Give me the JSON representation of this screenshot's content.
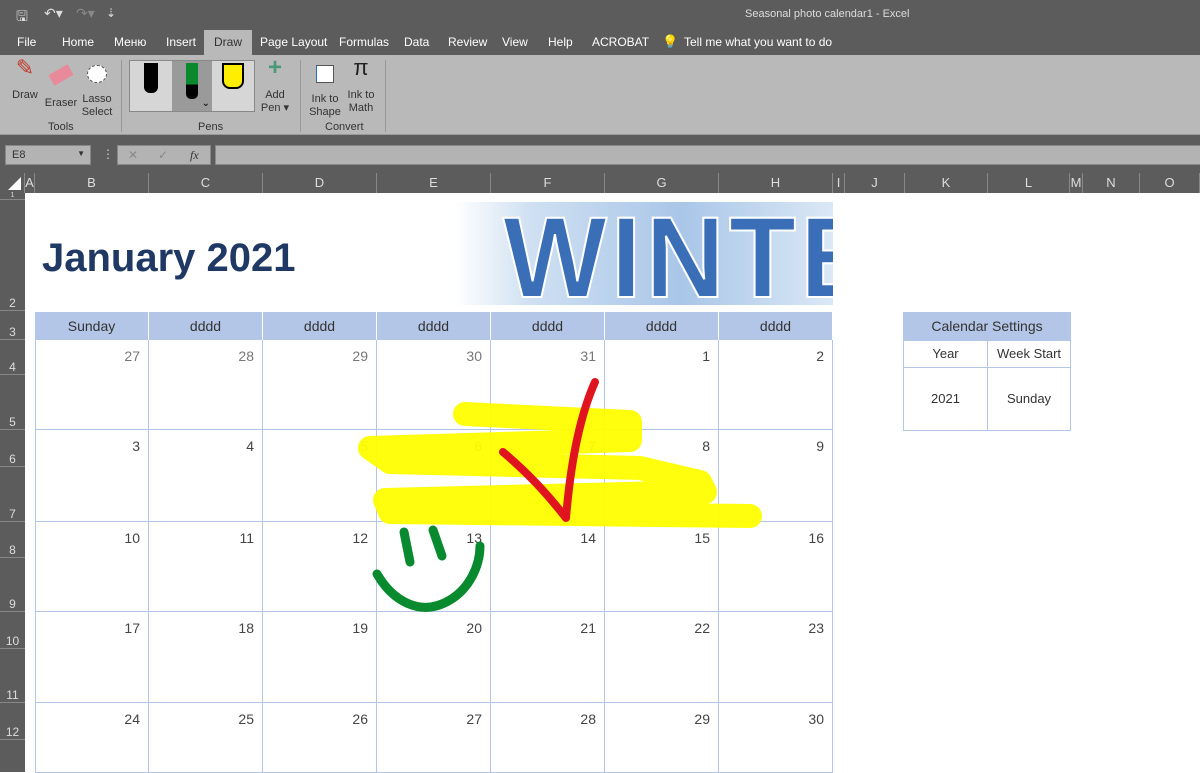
{
  "window": {
    "title": "Seasonal photo calendar1  -  Excel"
  },
  "tabs": [
    "File",
    "Home",
    "Меню",
    "Insert",
    "Draw",
    "Page Layout",
    "Formulas",
    "Data",
    "Review",
    "View",
    "Help",
    "ACROBAT"
  ],
  "tell_me": "Tell me what you want to do",
  "ribbon": {
    "draw": "Draw",
    "eraser": "Eraser",
    "lasso1": "Lasso",
    "lasso2": "Select",
    "tools": "Tools",
    "pens": "Pens",
    "addpen1": "Add",
    "addpen2": "Pen ▾",
    "shape1": "Ink to",
    "shape2": "Shape",
    "math1": "Ink to",
    "math2": "Math",
    "convert": "Convert"
  },
  "formula": {
    "namebox": "E8",
    "value": ""
  },
  "columns": [
    "A",
    "B",
    "C",
    "D",
    "E",
    "F",
    "G",
    "H",
    "I",
    "J",
    "K",
    "L",
    "M",
    "N",
    "O"
  ],
  "rows": [
    "1",
    "2",
    "3",
    "4",
    "5",
    "6",
    "7",
    "8",
    "9",
    "10",
    "11",
    "12"
  ],
  "calendar": {
    "title": "January 2021",
    "banner": "WINTER",
    "days": [
      "Sunday",
      "dddd",
      "dddd",
      "dddd",
      "dddd",
      "dddd",
      "dddd"
    ],
    "weeks": [
      [
        "27",
        "28",
        "29",
        "30",
        "31",
        "1",
        "2"
      ],
      [
        "3",
        "4",
        "5",
        "6",
        "7",
        "8",
        "9"
      ],
      [
        "10",
        "11",
        "12",
        "13",
        "14",
        "15",
        "16"
      ],
      [
        "17",
        "18",
        "19",
        "20",
        "21",
        "22",
        "23"
      ],
      [
        "24",
        "25",
        "26",
        "27",
        "28",
        "29",
        "30"
      ]
    ]
  },
  "settings": {
    "title": "Calendar Settings",
    "year_label": "Year",
    "week_label": "Week Start",
    "year": "2021",
    "week": "Sunday"
  },
  "ink_colors": {
    "highlighter": "#ffff00",
    "red": "#e0141e",
    "green": "#0a8a2e"
  }
}
